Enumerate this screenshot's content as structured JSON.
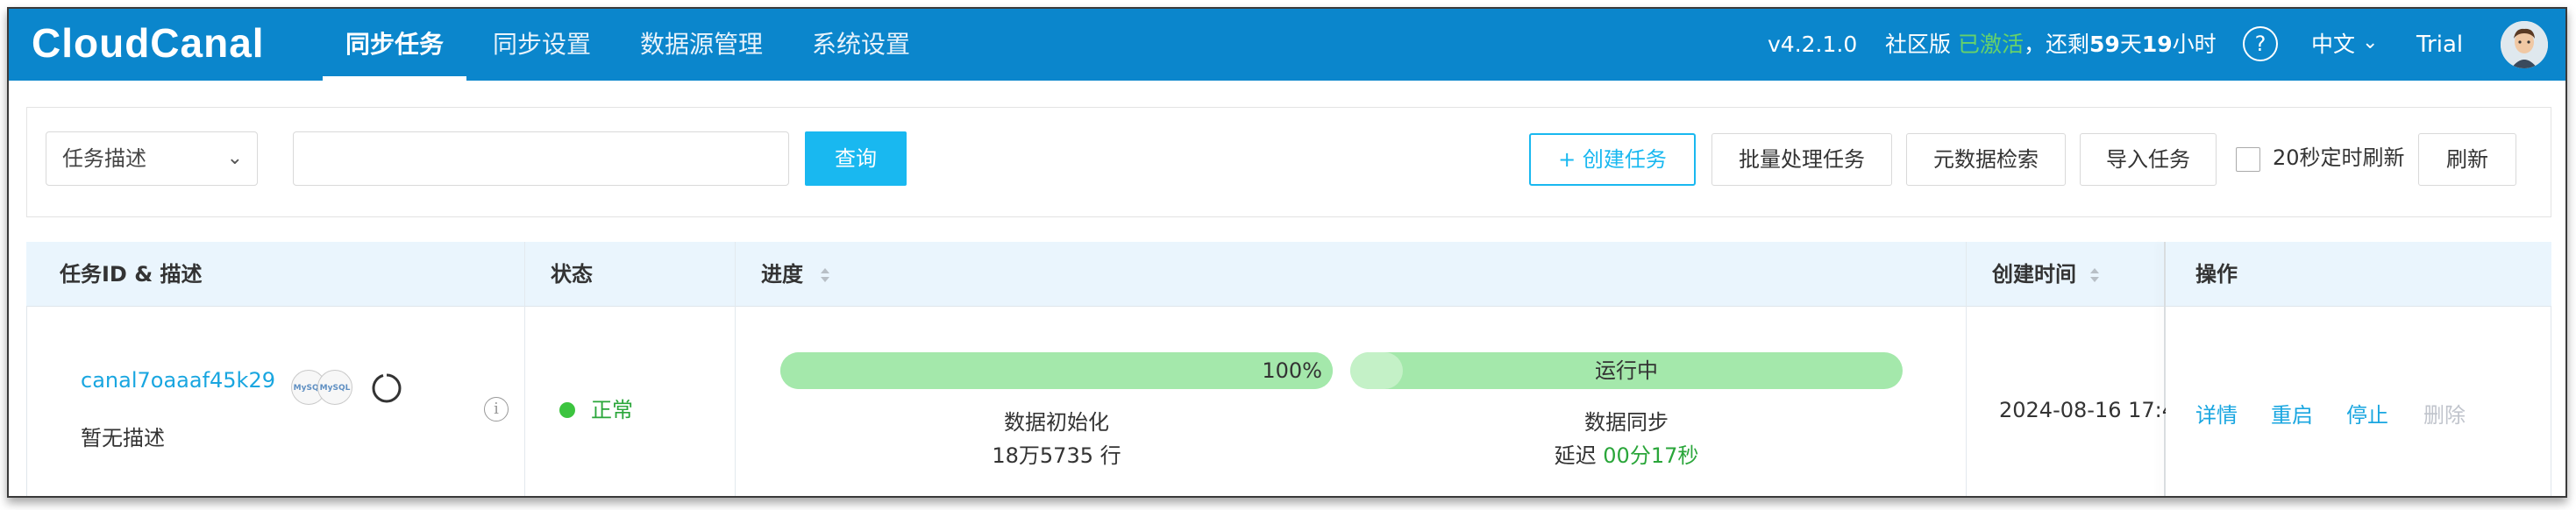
{
  "app": {
    "logo": "CloudCanal"
  },
  "nav": {
    "items": [
      {
        "label": "同步任务",
        "active": true
      },
      {
        "label": "同步设置",
        "active": false
      },
      {
        "label": "数据源管理",
        "active": false
      },
      {
        "label": "系统设置",
        "active": false
      }
    ]
  },
  "header_right": {
    "version": "v4.2.1.0",
    "edition": "社区版",
    "activated": "已激活",
    "comma": "，",
    "remaining_prefix": "还剩",
    "remaining_days": "59",
    "day_unit": "天",
    "remaining_hours": "19",
    "hour_unit": "小时",
    "help_icon": "?",
    "language": "中文",
    "language_chevron": "⌄",
    "trial": "Trial"
  },
  "toolbar": {
    "select_value": "任务描述",
    "select_chevron": "⌄",
    "search_value": "",
    "search_placeholder": "",
    "query_label": "查询",
    "create_label": "+ 创建任务",
    "batch_label": "批量处理任务",
    "metadata_label": "元数据检索",
    "import_label": "导入任务",
    "auto_refresh_label": "20秒定时刷新",
    "auto_refresh_checked": false,
    "refresh_label": "刷新"
  },
  "table": {
    "headers": {
      "task": "任务ID & 描述",
      "status": "状态",
      "progress": "进度",
      "created": "创建时间",
      "actions": "操作"
    },
    "row": {
      "task_id": "canal7oaaaf45k29",
      "description": "暂无描述",
      "db_icons": [
        "MySQL",
        "MySQL"
      ],
      "info_icon": "i",
      "status": "正常",
      "init_progress_text": "100%",
      "init_progress": 1.0,
      "init_label": "数据初始化",
      "init_rows": "18万5735 行",
      "sync_status": "运行中",
      "sync_label": "数据同步",
      "delay_prefix": "延迟",
      "delay_value": "00分17秒",
      "created_time": "2024-08-16 17:4",
      "actions": {
        "detail": "详情",
        "restart": "重启",
        "stop": "停止",
        "delete": "删除"
      }
    }
  },
  "colors": {
    "header_bg": "#0b86cc",
    "accent": "#19b8f0",
    "link": "#19a6e0",
    "success": "#2aa63a",
    "progress_bar": "#a4e8ab",
    "activated": "#67d26a"
  }
}
